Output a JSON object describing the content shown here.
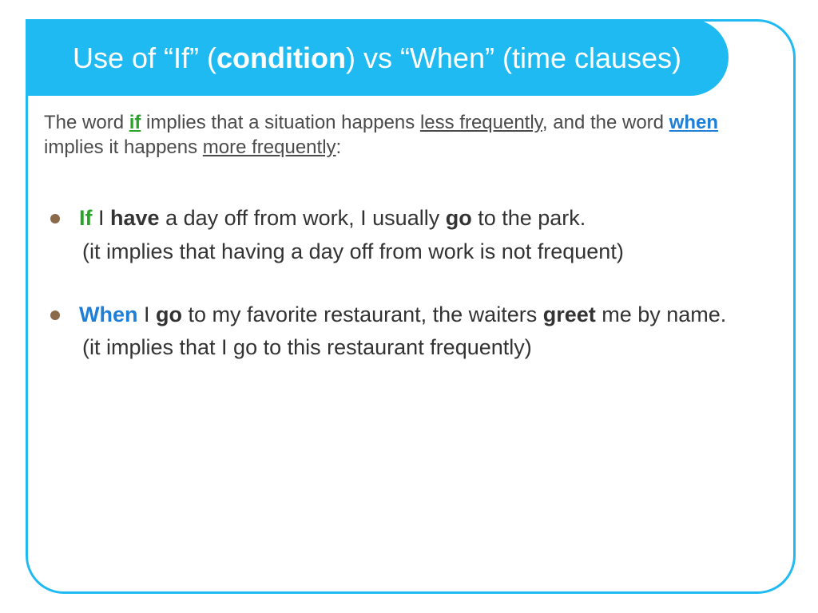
{
  "header": {
    "pre": "Use of “If” (",
    "cond": "condition",
    "post": ") vs “When” (time clauses)"
  },
  "intro": {
    "t1": "The word ",
    "if": "if",
    "t2": " implies that a situation happens ",
    "less": "less frequently",
    "t3": ", and the word ",
    "when": "when",
    "t4": " implies it happens ",
    "more": "more frequently",
    "t5": ":"
  },
  "ex1": {
    "kw": "If",
    "s1": " I ",
    "v1": "have",
    "s2": " a day off from work, I usually ",
    "v2": "go",
    "s3": " to the park.",
    "note": "(it implies that having a day off from work is not frequent)"
  },
  "ex2": {
    "kw": "When",
    "s1": " I ",
    "v1": "go",
    "s2": " to my favorite restaurant, the waiters ",
    "v2": "greet",
    "s3": " me by name.",
    "note": "(it implies that I go to this restaurant frequently)"
  }
}
